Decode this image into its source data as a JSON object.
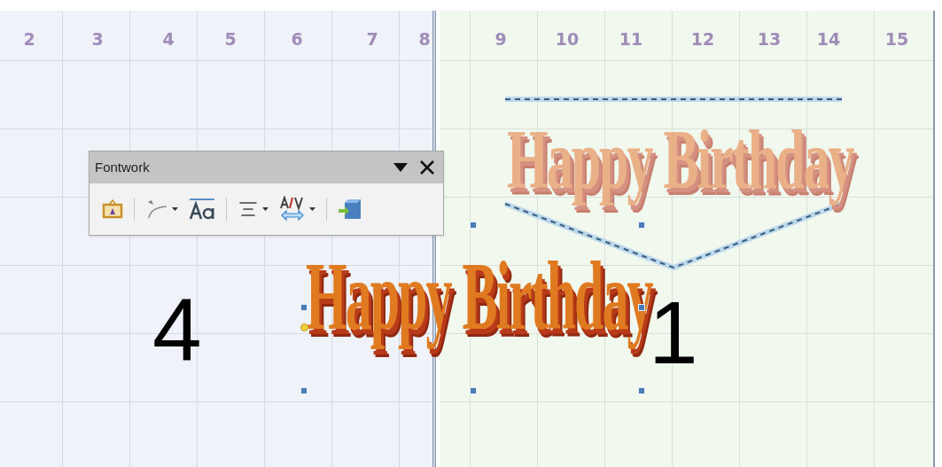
{
  "ruler": [
    "2",
    "3",
    "4",
    "5",
    "6",
    "7",
    "8",
    "9",
    "10",
    "11",
    "12",
    "13",
    "14",
    "15"
  ],
  "toolbar": {
    "title": "Fontwork",
    "tools": [
      {
        "kind": "gallery",
        "dropdown": false
      },
      {
        "kind": "shape",
        "dropdown": true
      },
      {
        "kind": "same-height",
        "dropdown": false
      },
      {
        "kind": "alignment",
        "dropdown": true
      },
      {
        "kind": "spacing",
        "dropdown": true
      },
      {
        "kind": "extrusion",
        "dropdown": false
      }
    ]
  },
  "pages": [
    {
      "number": "4"
    },
    {
      "number": "1"
    }
  ],
  "fontwork": [
    {
      "text": "Happy Birthday",
      "selected": false
    },
    {
      "text": "Happy Birthday",
      "selected": true
    }
  ]
}
